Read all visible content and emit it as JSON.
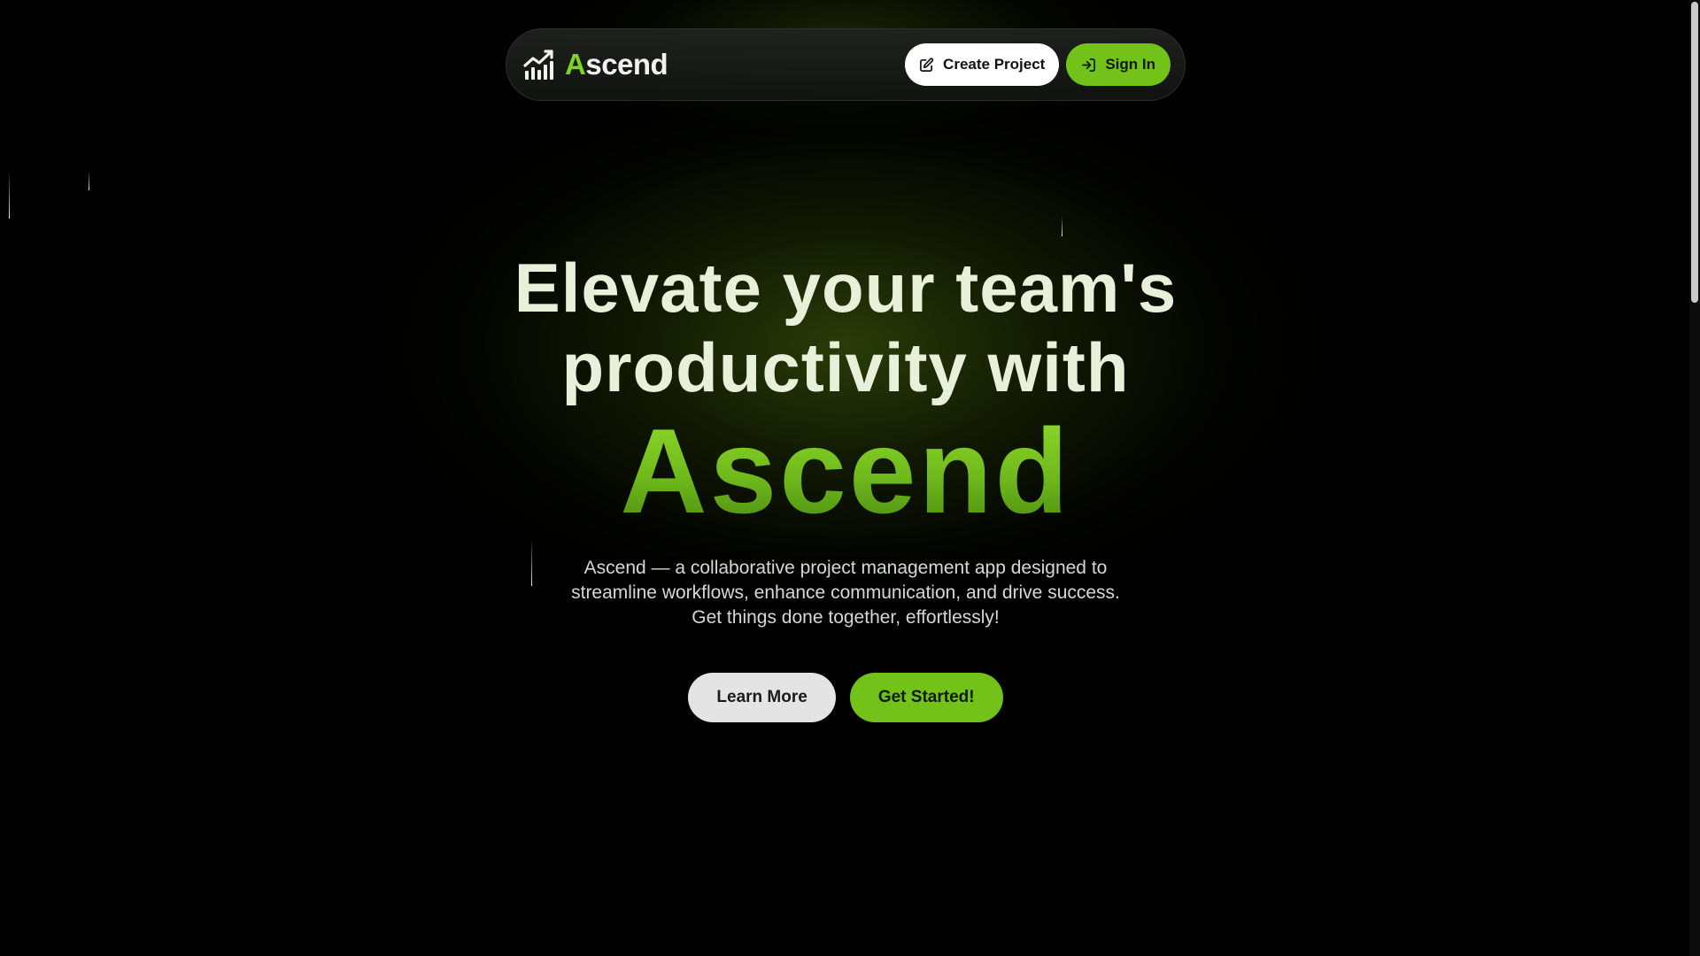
{
  "brand": {
    "accent_letter": "A",
    "rest": "scend",
    "icon": "chart-growth-icon"
  },
  "nav": {
    "create_project": {
      "label": "Create Project",
      "icon": "edit-icon"
    },
    "sign_in": {
      "label": "Sign In",
      "icon": "sign-in-icon"
    }
  },
  "hero": {
    "title_line1": "Elevate your team's",
    "title_line2": "productivity with",
    "brand_word": "Ascend",
    "description": [
      "Ascend — a collaborative project management app designed to",
      "streamline workflows, enhance communication, and drive success.",
      "Get things done together, effortlessly!"
    ]
  },
  "cta": {
    "learn_more": "Learn More",
    "get_started": "Get Started!"
  },
  "colors": {
    "accent": "#72c21a",
    "background": "#000000",
    "title": "#e9f0da"
  }
}
